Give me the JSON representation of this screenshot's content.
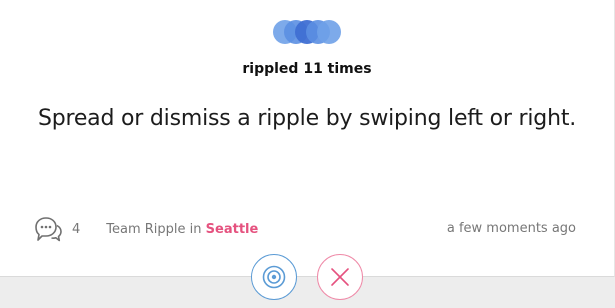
{
  "ripple": {
    "count_text": "rippled 11 times"
  },
  "message": {
    "text": "Spread or dismiss a ripple by swiping left or right."
  },
  "footer": {
    "comment_count": "4",
    "team_prefix": "Team Ripple in ",
    "city": "Seattle",
    "timestamp": "a few moments ago"
  },
  "colors": {
    "accent_blue": "#5b9bd5",
    "accent_pink": "#e5527f",
    "logo_blue": "#4a7fd8"
  },
  "icons": {
    "logo": "ripple-logo-icon",
    "comment": "comment-icon",
    "spread": "ripple-spread-icon",
    "dismiss": "close-icon"
  }
}
